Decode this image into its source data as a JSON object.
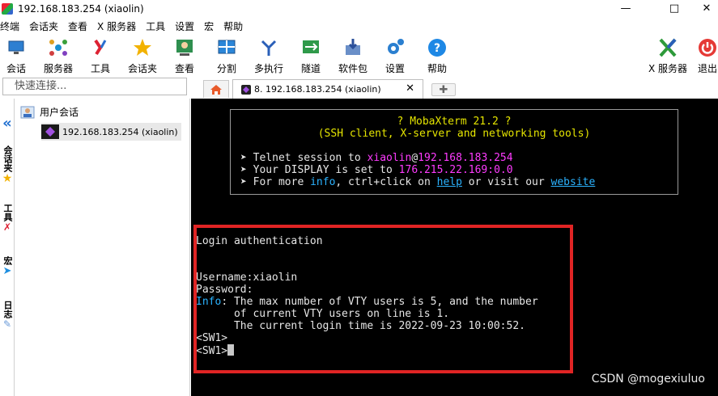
{
  "window": {
    "title": "192.168.183.254 (xiaolin)"
  },
  "menu": [
    "终端",
    "会话夹",
    "查看",
    "X 服务器",
    "工具",
    "设置",
    "宏",
    "帮助"
  ],
  "toolbar": {
    "session": "会话",
    "servers": "服务器",
    "tools": "工具",
    "sessions_folder": "会话夹",
    "view": "查看",
    "split": "分割",
    "multiexec": "多执行",
    "tunnel": "隧道",
    "packages": "软件包",
    "settings": "设置",
    "help": "帮助",
    "xserver": "X 服务器",
    "exit": "退出"
  },
  "quick_connect": {
    "placeholder": "快速连接..."
  },
  "tab": {
    "label": "8. 192.168.183.254 (xiaolin)"
  },
  "sidebar": {
    "vtabs": {
      "sessions": "会话夹",
      "tools": "工具",
      "macros": "宏",
      "log": "日志"
    },
    "root": "用户会话",
    "child": "192.168.183.254 (xiaolin)"
  },
  "terminal": {
    "banner_title": "? MobaXterm 21.2 ?",
    "banner_subtitle": "(SSH client, X-server and networking tools)",
    "telnet_prefix": "➤ Telnet session to ",
    "telnet_user": "xiaolin",
    "telnet_at": "@",
    "telnet_host": "192.168.183.254",
    "display_prefix": "➤ Your DISPLAY is set to ",
    "display_value": "176.215.22.169:0.0",
    "more_prefix": "➤ For more ",
    "more_info": "info",
    "more_mid": ", ctrl+click on ",
    "more_help": "help",
    "more_or": " or visit our ",
    "more_site": "website",
    "lines": {
      "login": "Login authentication",
      "username": "Username:xiaolin",
      "password": "Password:",
      "info_label": "Info",
      "info1": ": The max number of VTY users is 5, and the number",
      "info2": "      of current VTY users on line is 1.",
      "info3": "      The current login time is 2022-09-23 10:00:52.",
      "prompt1": "<SW1>",
      "prompt2": "<SW1>"
    }
  },
  "watermark": "CSDN @mogexiuluo",
  "colors": {
    "highlight_box": "#e02424",
    "terminal_bg": "#000000",
    "banner_yellow": "#e5e500",
    "magenta": "#ff3bff",
    "link_blue": "#2bb3ff"
  }
}
